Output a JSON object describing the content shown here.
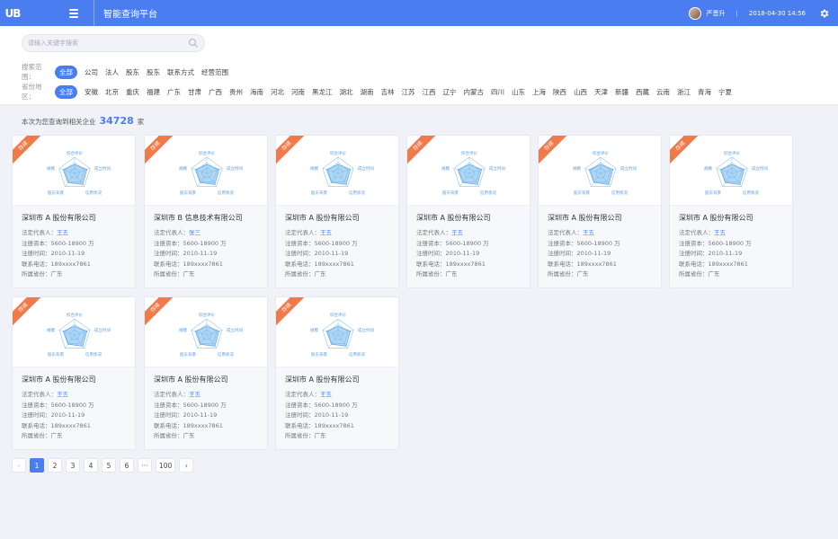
{
  "header": {
    "logo": "UB",
    "title": "智能查询平台",
    "user": "严晋升",
    "datetime": "2018-04-30 14:56",
    "separator": "|"
  },
  "search": {
    "placeholder": "请输入关键字搜索"
  },
  "scope": {
    "label": "搜索范围：",
    "options": [
      "全部",
      "公司",
      "法人",
      "股东",
      "股东",
      "联系方式",
      "经营范围"
    ]
  },
  "province": {
    "label": "省份地区：",
    "options": [
      "全部",
      "安徽",
      "北京",
      "重庆",
      "福建",
      "广东",
      "甘肃",
      "广西",
      "贵州",
      "海南",
      "河北",
      "河南",
      "黑龙江",
      "湖北",
      "湖南",
      "吉林",
      "江苏",
      "江西",
      "辽宁",
      "内蒙古",
      "四川",
      "山东",
      "上海",
      "陕西",
      "山西",
      "天津",
      "新疆",
      "西藏",
      "云南",
      "浙江",
      "青海",
      "宁夏"
    ]
  },
  "result": {
    "prefix": "本次为您查询到相关企业",
    "count": "34728",
    "suffix": "家"
  },
  "card_labels": {
    "badge": "存续",
    "radar_axes": [
      "综合评价",
      "成立时间",
      "信用状况",
      "股东背景",
      "规模"
    ],
    "legal_rep_label": "法定代表人：",
    "capital_label": "注册资本：",
    "reg_date_label": "注册时间：",
    "phone_label": "联系电话：",
    "province_label": "所属省份："
  },
  "cards": [
    {
      "name": "深圳市 A 股份有限公司",
      "legal_rep": "王五",
      "capital": "5600-18900 万",
      "reg_date": "2010-11-19",
      "phone": "189xxxx7861",
      "province": "广东"
    },
    {
      "name": "深圳市 B 信息技术有限公司",
      "legal_rep": "张三",
      "capital": "5600-18900 万",
      "reg_date": "2010-11-19",
      "phone": "189xxxx7861",
      "province": "广东"
    },
    {
      "name": "深圳市 A 股份有限公司",
      "legal_rep": "王五",
      "capital": "5600-18900 万",
      "reg_date": "2010-11-19",
      "phone": "189xxxx7861",
      "province": "广东"
    },
    {
      "name": "深圳市 A 股份有限公司",
      "legal_rep": "王五",
      "capital": "5600-18900 万",
      "reg_date": "2010-11-19",
      "phone": "189xxxx7861",
      "province": "广东"
    },
    {
      "name": "深圳市 A 股份有限公司",
      "legal_rep": "王五",
      "capital": "5600-18900 万",
      "reg_date": "2010-11-19",
      "phone": "189xxxx7861",
      "province": "广东"
    },
    {
      "name": "深圳市 A 股份有限公司",
      "legal_rep": "王五",
      "capital": "5600-18900 万",
      "reg_date": "2010-11-19",
      "phone": "189xxxx7861",
      "province": "广东"
    },
    {
      "name": "深圳市 A 股份有限公司",
      "legal_rep": "王五",
      "capital": "5600-18900 万",
      "reg_date": "2010-11-19",
      "phone": "189xxxx7861",
      "province": "广东"
    },
    {
      "name": "深圳市 A 股份有限公司",
      "legal_rep": "王五",
      "capital": "5600-18900 万",
      "reg_date": "2010-11-19",
      "phone": "189xxxx7861",
      "province": "广东"
    },
    {
      "name": "深圳市 A 股份有限公司",
      "legal_rep": "王五",
      "capital": "5600-18900 万",
      "reg_date": "2010-11-19",
      "phone": "189xxxx7861",
      "province": "广东"
    }
  ],
  "pagination": {
    "prev": "‹",
    "pages": [
      "1",
      "2",
      "3",
      "4",
      "5",
      "6",
      "···",
      "100"
    ],
    "current": "1",
    "next": "›"
  },
  "colors": {
    "primary": "#4a7df0",
    "badge": "#f07a4a",
    "radar": "#5a9de0"
  }
}
